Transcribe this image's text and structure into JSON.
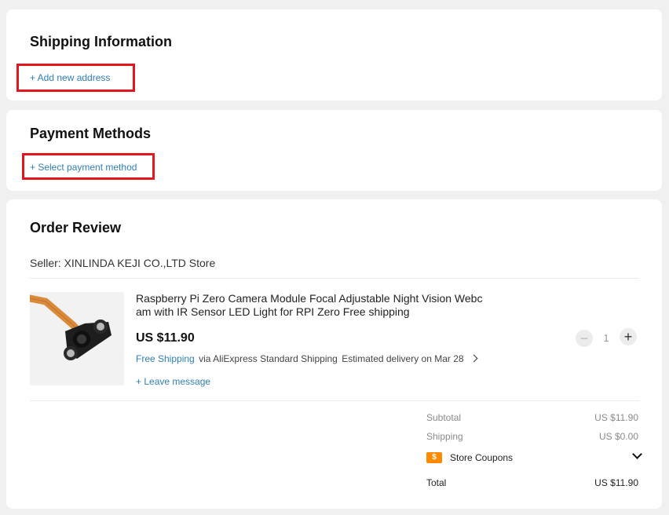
{
  "shipping": {
    "title": "Shipping Information",
    "add_address_label": "+ Add new address"
  },
  "payment": {
    "title": "Payment Methods",
    "select_label": "+ Select payment method"
  },
  "review": {
    "title": "Order Review",
    "seller": "Seller: XINLINDA KEJI CO.,LTD Store",
    "product": {
      "name_line1": "Raspberry Pi Zero Camera Module Focal Adjustable Night Vision Webc",
      "name_line2": "am with IR Sensor LED Light for RPI Zero Free shipping",
      "price": "US $11.90",
      "free_shipping": "Free Shipping",
      "shipping_via": "via AliExpress Standard Shipping",
      "delivery": "Estimated delivery on Mar 28",
      "quantity": "1",
      "leave_message": "+ Leave message"
    },
    "summary": {
      "subtotal_label": "Subtotal",
      "subtotal_value": "US $11.90",
      "shipping_label": "Shipping",
      "shipping_value": "US $0.00",
      "coupons_label": "Store Coupons",
      "total_label": "Total",
      "total_value": "US $11.90"
    }
  },
  "colors": {
    "accent_blue": "#2e7fb8",
    "highlight_red": "#e3151f",
    "coupon_orange": "#ff8a00"
  }
}
